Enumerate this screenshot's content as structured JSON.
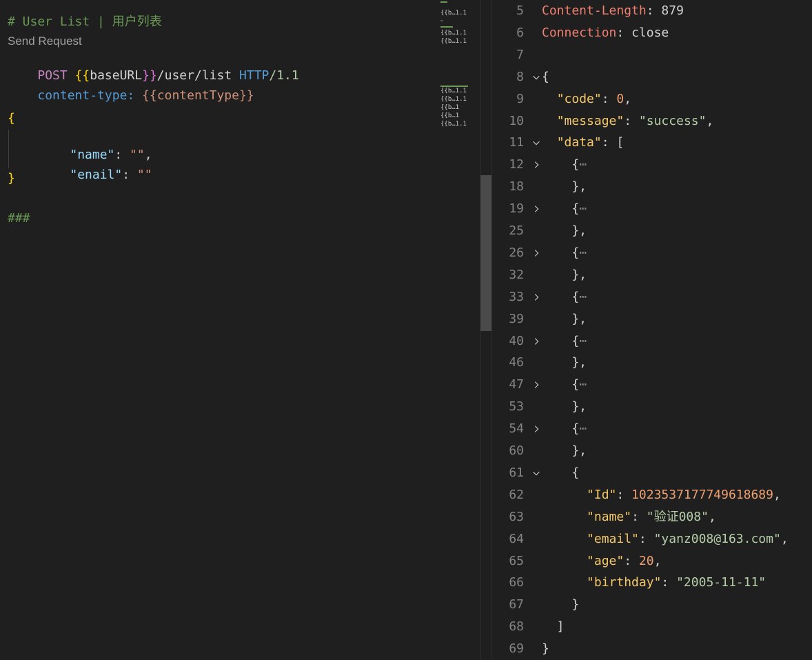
{
  "editor": {
    "title_comment": "# User List | 用户列表",
    "codelens": "Send Request",
    "request_line": {
      "method": "POST",
      "open_braces": "{{",
      "variable": "baseURL",
      "close_braces": "}}",
      "path": "/user/list",
      "protocol": "HTTP",
      "version": "/1.1"
    },
    "header_line": {
      "key": "content-type:",
      "value": "{{contentType}}"
    },
    "body": {
      "open": "{",
      "fields": [
        {
          "key": "\"name\"",
          "sep": ": ",
          "value": "\"\"",
          "trail": ","
        },
        {
          "key": "\"enail\"",
          "sep": ": ",
          "value": "\"\"",
          "trail": ""
        }
      ],
      "close": "}"
    },
    "separator": "###",
    "minimap": [
      "{{b…1.1",
      "{{b…1.1",
      "{{b…1.1",
      "{{b…1.1",
      "{{b…1.1",
      "{{b…1",
      "{{b…1",
      "{{b…1.1"
    ]
  },
  "response": {
    "lines": [
      {
        "num": "5",
        "fold": "",
        "segs": [
          [
            "Content-Length",
            "rkey"
          ],
          [
            ": ",
            "punct"
          ],
          [
            "879",
            "plain"
          ]
        ]
      },
      {
        "num": "6",
        "fold": "",
        "segs": [
          [
            "Connection",
            "rkey"
          ],
          [
            ": ",
            "punct"
          ],
          [
            "close",
            "plain"
          ]
        ]
      },
      {
        "num": "7",
        "fold": "",
        "segs": []
      },
      {
        "num": "8",
        "fold": "open",
        "segs": [
          [
            "{",
            "punct"
          ]
        ]
      },
      {
        "num": "9",
        "fold": "",
        "segs": [
          [
            "  ",
            "punct"
          ],
          [
            "\"code\"",
            "jkey"
          ],
          [
            ": ",
            "punct"
          ],
          [
            "0",
            "jnum"
          ],
          [
            ",",
            "punct"
          ]
        ]
      },
      {
        "num": "10",
        "fold": "",
        "segs": [
          [
            "  ",
            "punct"
          ],
          [
            "\"message\"",
            "jkey"
          ],
          [
            ": ",
            "punct"
          ],
          [
            "\"success\"",
            "jstr"
          ],
          [
            ",",
            "punct"
          ]
        ]
      },
      {
        "num": "11",
        "fold": "open",
        "segs": [
          [
            "  ",
            "punct"
          ],
          [
            "\"data\"",
            "jkey"
          ],
          [
            ": [",
            "punct"
          ]
        ]
      },
      {
        "num": "12",
        "fold": "closed",
        "segs": [
          [
            "    {",
            "punct"
          ],
          [
            "⋯",
            "ell"
          ]
        ]
      },
      {
        "num": "18",
        "fold": "",
        "segs": [
          [
            "    },",
            "punct"
          ]
        ]
      },
      {
        "num": "19",
        "fold": "closed",
        "segs": [
          [
            "    {",
            "punct"
          ],
          [
            "⋯",
            "ell"
          ]
        ]
      },
      {
        "num": "25",
        "fold": "",
        "segs": [
          [
            "    },",
            "punct"
          ]
        ]
      },
      {
        "num": "26",
        "fold": "closed",
        "segs": [
          [
            "    {",
            "punct"
          ],
          [
            "⋯",
            "ell"
          ]
        ]
      },
      {
        "num": "32",
        "fold": "",
        "segs": [
          [
            "    },",
            "punct"
          ]
        ]
      },
      {
        "num": "33",
        "fold": "closed",
        "segs": [
          [
            "    {",
            "punct"
          ],
          [
            "⋯",
            "ell"
          ]
        ]
      },
      {
        "num": "39",
        "fold": "",
        "segs": [
          [
            "    },",
            "punct"
          ]
        ]
      },
      {
        "num": "40",
        "fold": "closed",
        "segs": [
          [
            "    {",
            "punct"
          ],
          [
            "⋯",
            "ell"
          ]
        ]
      },
      {
        "num": "46",
        "fold": "",
        "segs": [
          [
            "    },",
            "punct"
          ]
        ]
      },
      {
        "num": "47",
        "fold": "closed",
        "segs": [
          [
            "    {",
            "punct"
          ],
          [
            "⋯",
            "ell"
          ]
        ]
      },
      {
        "num": "53",
        "fold": "",
        "segs": [
          [
            "    },",
            "punct"
          ]
        ]
      },
      {
        "num": "54",
        "fold": "closed",
        "segs": [
          [
            "    {",
            "punct"
          ],
          [
            "⋯",
            "ell"
          ]
        ]
      },
      {
        "num": "60",
        "fold": "",
        "segs": [
          [
            "    },",
            "punct"
          ]
        ]
      },
      {
        "num": "61",
        "fold": "open",
        "segs": [
          [
            "    {",
            "punct"
          ]
        ]
      },
      {
        "num": "62",
        "fold": "",
        "segs": [
          [
            "      ",
            "punct"
          ],
          [
            "\"Id\"",
            "jkey"
          ],
          [
            ": ",
            "punct"
          ],
          [
            "1023537177749618689",
            "jnum"
          ],
          [
            ",",
            "punct"
          ]
        ]
      },
      {
        "num": "63",
        "fold": "",
        "segs": [
          [
            "      ",
            "punct"
          ],
          [
            "\"name\"",
            "jkey"
          ],
          [
            ": ",
            "punct"
          ],
          [
            "\"验证008\"",
            "jstr"
          ],
          [
            ",",
            "punct"
          ]
        ]
      },
      {
        "num": "64",
        "fold": "",
        "segs": [
          [
            "      ",
            "punct"
          ],
          [
            "\"email\"",
            "jkey"
          ],
          [
            ": ",
            "punct"
          ],
          [
            "\"yanz008@163.com\"",
            "jstr"
          ],
          [
            ",",
            "punct"
          ]
        ]
      },
      {
        "num": "65",
        "fold": "",
        "segs": [
          [
            "      ",
            "punct"
          ],
          [
            "\"age\"",
            "jkey"
          ],
          [
            ": ",
            "punct"
          ],
          [
            "20",
            "jnum"
          ],
          [
            ",",
            "punct"
          ]
        ]
      },
      {
        "num": "66",
        "fold": "",
        "segs": [
          [
            "      ",
            "punct"
          ],
          [
            "\"birthday\"",
            "jkey"
          ],
          [
            ": ",
            "punct"
          ],
          [
            "\"2005-11-11\"",
            "jstr"
          ]
        ]
      },
      {
        "num": "67",
        "fold": "",
        "segs": [
          [
            "    }",
            "punct"
          ]
        ]
      },
      {
        "num": "68",
        "fold": "",
        "segs": [
          [
            "  ]",
            "punct"
          ]
        ]
      },
      {
        "num": "69",
        "fold": "",
        "segs": [
          [
            "}",
            "punct"
          ]
        ]
      }
    ]
  }
}
